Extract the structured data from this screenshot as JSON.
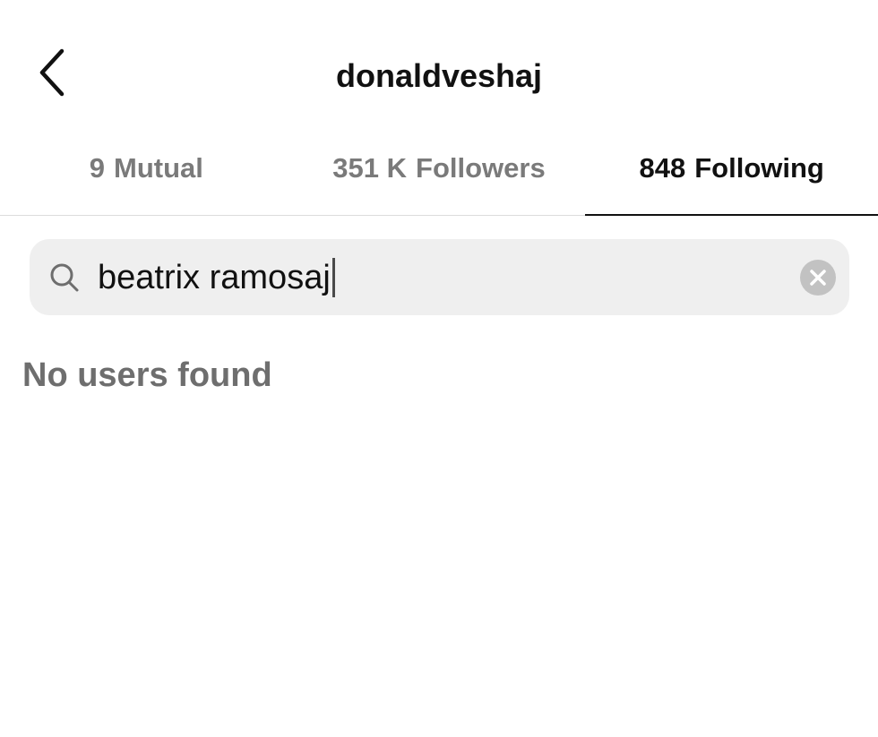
{
  "header": {
    "username": "donaldveshaj",
    "back_icon": "chevron-left-icon"
  },
  "tabs": [
    {
      "count": "9",
      "label": "Mutual",
      "active": false
    },
    {
      "count": "351 K",
      "label": "Followers",
      "active": false
    },
    {
      "count": "848",
      "label": "Following",
      "active": true
    }
  ],
  "search": {
    "value": "beatrix ramosaj",
    "icon": "search-icon",
    "clear_icon": "clear-icon"
  },
  "results": {
    "empty_message": "No users found"
  },
  "colors": {
    "text_primary": "#111111",
    "text_secondary": "#7a7a7a",
    "search_bg": "#efefef",
    "clear_bg": "#c2c2c2"
  }
}
